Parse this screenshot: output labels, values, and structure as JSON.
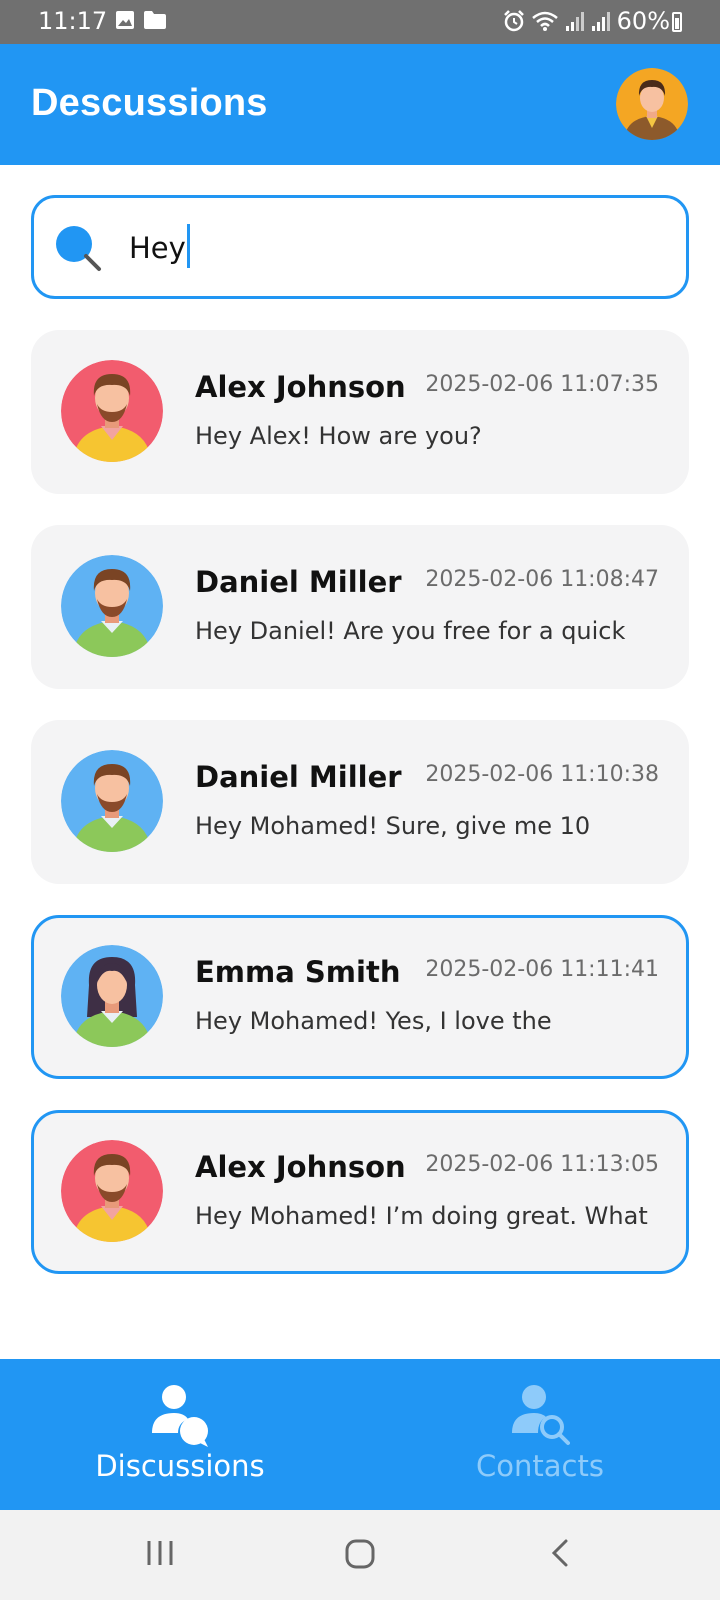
{
  "status_bar": {
    "time": "11:17",
    "battery": "60%",
    "icons": [
      "image-icon",
      "folder-icon",
      "alarm-icon",
      "wifi-icon",
      "signal-icon",
      "signal-icon-2",
      "battery-icon"
    ]
  },
  "app_bar": {
    "title": "Descussions"
  },
  "search": {
    "value": "Hey",
    "accent": "#2196f3"
  },
  "chats": [
    {
      "name": "Alex Johnson",
      "time": "2025-02-06 11:07:35",
      "message": "Hey Alex! How are you?",
      "avatar": "alex",
      "highlighted": false
    },
    {
      "name": "Daniel Miller",
      "time": "2025-02-06 11:08:47",
      "message": "Hey Daniel! Are you free for a quick",
      "avatar": "daniel",
      "highlighted": false
    },
    {
      "name": "Daniel Miller",
      "time": "2025-02-06 11:10:38",
      "message": "Hey Mohamed! Sure, give me 10",
      "avatar": "daniel",
      "highlighted": false
    },
    {
      "name": "Emma Smith",
      "time": "2025-02-06 11:11:41",
      "message": "Hey Mohamed! Yes, I love the",
      "avatar": "emma",
      "highlighted": true
    },
    {
      "name": "Alex Johnson",
      "time": "2025-02-06 11:13:05",
      "message": "Hey Mohamed! I’m doing great. What",
      "avatar": "alex",
      "highlighted": true
    }
  ],
  "bottom_nav": {
    "discussions_label": "Discussions",
    "contacts_label": "Contacts",
    "active": "discussions"
  },
  "colors": {
    "primary": "#2196f3",
    "card_bg": "#f4f4f5",
    "inactive_nav": "#8ecbfa"
  }
}
